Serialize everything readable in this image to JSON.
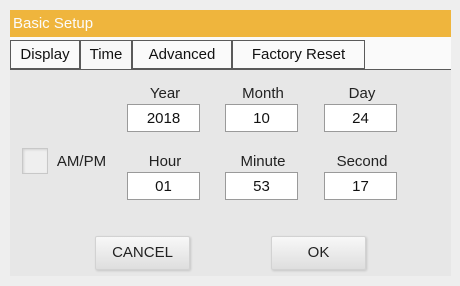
{
  "window": {
    "title": "Basic Setup"
  },
  "tabs": [
    {
      "label": "Display"
    },
    {
      "label": "Time",
      "active": true
    },
    {
      "label": "Advanced"
    },
    {
      "label": "Factory Reset"
    }
  ],
  "date": {
    "year_label": "Year",
    "year_value": "2018",
    "month_label": "Month",
    "month_value": "10",
    "day_label": "Day",
    "day_value": "24"
  },
  "time": {
    "hour_label": "Hour",
    "hour_value": "01",
    "minute_label": "Minute",
    "minute_value": "53",
    "second_label": "Second",
    "second_value": "17"
  },
  "ampm": {
    "label": "AM/PM",
    "checked": false
  },
  "buttons": {
    "cancel": "CANCEL",
    "ok": "OK"
  },
  "colors": {
    "titlebar": "#efb53d",
    "panel": "#e7e7e7"
  }
}
